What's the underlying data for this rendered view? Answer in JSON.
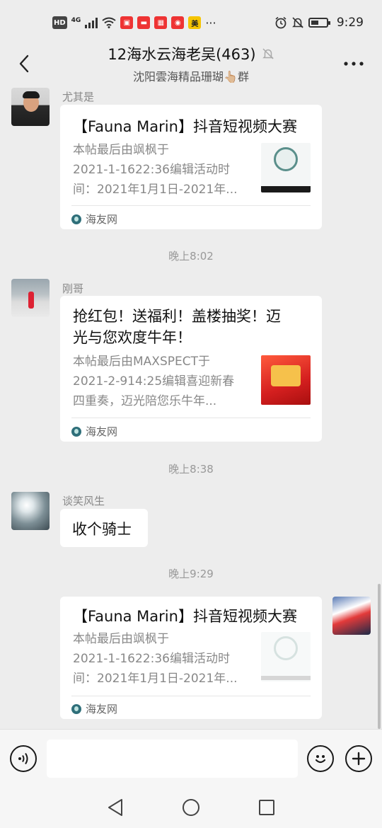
{
  "status_bar": {
    "network": "HD",
    "network_gen": "4G",
    "time": "9:29",
    "more_label": "···",
    "app_chip_label": "美"
  },
  "header": {
    "title": "12海水云海老吴(463)",
    "subtitle": "沈阳雲海精品珊瑚👆🏼群"
  },
  "messages": [
    {
      "sender": "尤其是",
      "type": "card",
      "title": "【Fauna Marin】抖音短视频大赛",
      "description": "本帖最后由飒枫于2021-1-1622:36编辑活动时间：2021年1月1日-2021年...",
      "desc_lines": [
        "本帖最后由飒枫于",
        "2021-1-1622:36编辑活动时",
        "间：2021年1月1日-2021年..."
      ],
      "source": "海友网"
    },
    {
      "type": "time",
      "text": "晚上8:02"
    },
    {
      "sender": "刚哥",
      "type": "card",
      "title": "抢红包！送福利！盖楼抽奖！迈光与您欢度牛年！",
      "title_lines": [
        "抢红包！送福利！盖楼抽奖！迈",
        "光与您欢度牛年！"
      ],
      "desc_lines": [
        "本帖最后由MAXSPECT于",
        "2021-2-914:25编辑喜迎新春",
        "四重奏，迈光陪您乐牛年..."
      ],
      "source": "海友网"
    },
    {
      "type": "time",
      "text": "晚上8:38"
    },
    {
      "sender": "谈笑风生",
      "type": "text",
      "text": "收个骑士"
    },
    {
      "type": "time",
      "text": "晚上9:29"
    },
    {
      "sender": "",
      "type": "card",
      "self": true,
      "title": "【Fauna Marin】抖音短视频大赛",
      "desc_lines": [
        "本帖最后由飒枫于",
        "2021-1-1622:36编辑活动时",
        "间：2021年1月1日-2021年..."
      ],
      "source": "海友网"
    }
  ],
  "input": {
    "value": "",
    "placeholder": ""
  },
  "colors": {
    "background": "#ededed",
    "bubble": "#ffffff",
    "muted_text": "#888888"
  },
  "icons": {
    "back": "back-arrow-icon",
    "more": "more-dots-icon",
    "mute": "bell-muted-icon",
    "voice": "voice-icon",
    "emoji": "emoji-icon",
    "add": "plus-icon"
  }
}
